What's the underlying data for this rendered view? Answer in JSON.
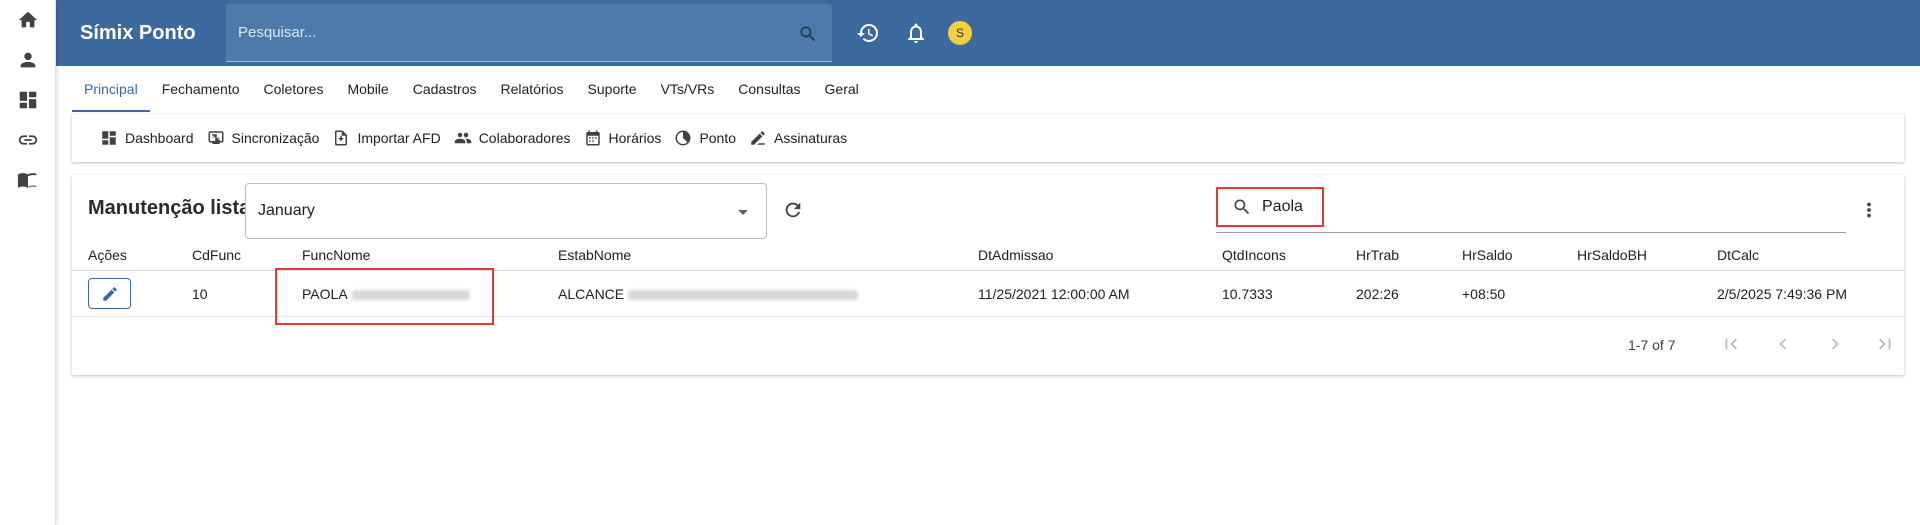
{
  "app": {
    "title": "Símix Ponto"
  },
  "search": {
    "placeholder": "Pesquisar..."
  },
  "user": {
    "avatar_letter": "S"
  },
  "rail": {
    "icons": [
      "home-icon",
      "person-icon",
      "dashboard-icon",
      "link-icon",
      "book-icon"
    ]
  },
  "tabs": [
    {
      "label": "Principal",
      "active": true
    },
    {
      "label": "Fechamento"
    },
    {
      "label": "Coletores"
    },
    {
      "label": "Mobile"
    },
    {
      "label": "Cadastros"
    },
    {
      "label": "Relatórios"
    },
    {
      "label": "Suporte"
    },
    {
      "label": "VTs/VRs"
    },
    {
      "label": "Consultas"
    },
    {
      "label": "Geral"
    }
  ],
  "subnav": [
    {
      "label": "Dashboard",
      "icon": "dashboard-icon"
    },
    {
      "label": "Sincronização",
      "icon": "sync-icon"
    },
    {
      "label": "Importar AFD",
      "icon": "import-icon"
    },
    {
      "label": "Colaboradores",
      "icon": "people-icon"
    },
    {
      "label": "Horários",
      "icon": "calendar-icon"
    },
    {
      "label": "Ponto",
      "icon": "clock-icon"
    },
    {
      "label": "Assinaturas",
      "icon": "signature-icon"
    }
  ],
  "list": {
    "title": "Manutenção lista",
    "month": "January",
    "filter_value": "Paola"
  },
  "table": {
    "headers": [
      "Ações",
      "CdFunc",
      "FuncNome",
      "EstabNome",
      "DtAdmissao",
      "QtdIncons",
      "HrTrab",
      "HrSaldo",
      "HrSaldoBH",
      "DtCalc"
    ],
    "rows": [
      {
        "cdfunc": "10",
        "funcnome": "PAOLA",
        "estabnome": "ALCANCE",
        "dtadmissao": "11/25/2021 12:00:00 AM",
        "qtdincons": "10.7333",
        "hrtrab": "202:26",
        "hrsaldo": "+08:50",
        "hrsaldobh": "",
        "dtcalc": "2/5/2025 7:49:36 PM"
      }
    ]
  },
  "pagination": {
    "range": "1-7 of 7"
  },
  "colors": {
    "primary": "#3c6a9e",
    "highlight": "#e53935",
    "avatar": "#f4d03f"
  }
}
